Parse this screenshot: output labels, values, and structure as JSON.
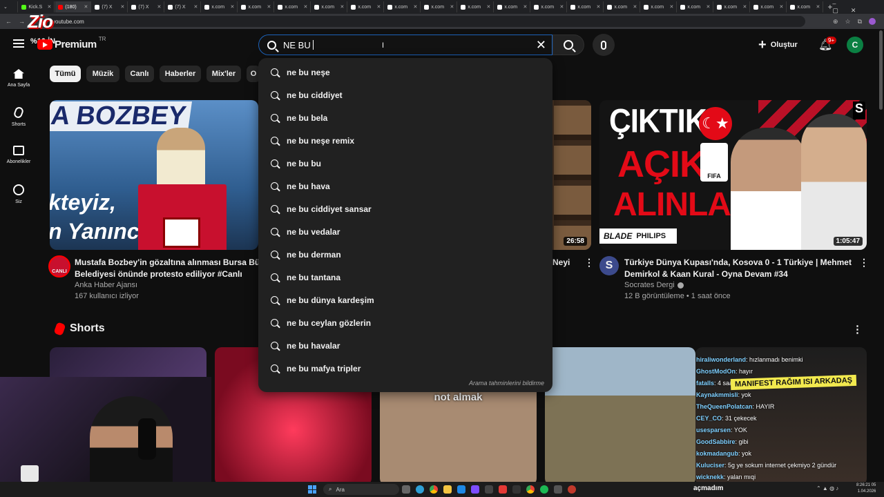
{
  "browser": {
    "tabs": [
      "Kick.S",
      "(180)",
      "(7) X",
      "(7) X",
      "(7) X",
      "x.com",
      "x.com",
      "x.com",
      "x.com",
      "x.com",
      "x.com",
      "x.com",
      "x.com",
      "x.com",
      "x.com",
      "x.com",
      "x.com",
      "x.com",
      "x.com",
      "x.com",
      "x.com",
      "x.com"
    ],
    "url": "youtube.com"
  },
  "overlay_logo": {
    "brand": "Zio",
    "promo": "%10 İN"
  },
  "header": {
    "premium_label": "Premium",
    "country_code": "TR",
    "search_value": "NE BU ",
    "create_label": "Oluştur",
    "notif_count": "9+",
    "avatar_letter": "C"
  },
  "sidebar": [
    {
      "label": "Ana Sayfa",
      "icon": "home-icon"
    },
    {
      "label": "Shorts",
      "icon": "shorts-icon"
    },
    {
      "label": "Abonelikler",
      "icon": "subscriptions-icon"
    },
    {
      "label": "Siz",
      "icon": "you-icon"
    }
  ],
  "chips": [
    "Tümü",
    "Müzik",
    "Canlı",
    "Haberler",
    "Mix'ler",
    "O"
  ],
  "suggestions": [
    "ne bu neşe",
    "ne bu ciddiyet",
    "ne bu bela",
    "ne bu neşe remix",
    "ne bu bu",
    "ne bu hava",
    "ne bu ciddiyet sansar",
    "ne bu vedalar",
    "ne bu derman",
    "ne bu tantana",
    "ne bu dünya kardeşim",
    "ne bu ceylan gözlerin",
    "ne bu havalar",
    "ne bu mafya tripler"
  ],
  "report_label": "Arama tahminlerini bildirme",
  "videos": [
    {
      "title_line1": "Mustafa Bozbey'in gözaltına alınması Bursa Büyük",
      "title_line2": "Belediyesi önünde protesto ediliyor #Canlı",
      "channel": "Anka Haber Ajansı",
      "meta": "167 kullanıcı izliyor",
      "live_badge": "CANLI",
      "thumb_text1": "A BOZBEY",
      "thumb_text2": "kteyiz,",
      "thumb_text3": "n Yanınc"
    },
    {
      "title_fragment": "Neyi",
      "duration": "26:58"
    },
    {
      "title_line1": "Türkiye Dünya Kupası'nda, Kosova 0 - 1 Türkiye | Mehmet",
      "title_line2": "Demirkol & Kaan Kural - Oyna Devam #34",
      "channel": "Socrates Dergi",
      "meta": "12 B görüntüleme • 1 saat önce",
      "duration": "1:05:47",
      "channel_initial": "S",
      "thumb_line1": "ÇIKTIK",
      "thumb_line2": "AÇIK",
      "thumb_line3": "ALINLA",
      "sponsor1": "BLADE",
      "sponsor2": "PHILIPS",
      "fifa": "FIFA",
      "corner": "S"
    }
  ],
  "shorts_label": "Shorts",
  "short_caption": "not almak",
  "stream_banner": "MANIFEST RAĞIM ISI ARKADAŞ",
  "chat": [
    {
      "user": "hiraliwonderland",
      "msg": "hızlanmadı benimki"
    },
    {
      "user": "GhostModOn",
      "msg": "hayır"
    },
    {
      "user": "fatalls",
      "msg": "4 saat..."
    },
    {
      "user": "Kaynakmmisli",
      "msg": "yok"
    },
    {
      "user": "TheQueenPolatcan",
      "msg": "HAYIR"
    },
    {
      "user": "CEY_CO",
      "msg": "31 çekecek"
    },
    {
      "user": "usesparsen",
      "msg": "YOK"
    },
    {
      "user": "GoodSabbire",
      "msg": "gibi"
    },
    {
      "user": "kokmadangub",
      "msg": "yok"
    },
    {
      "user": "Kuluciser",
      "msg": "5g ye sokum internet çekmiyo 2 gündür"
    },
    {
      "user": "wicknekk",
      "msg": "yalan mıqi"
    }
  ],
  "taskbar": {
    "search_label": "Ara",
    "active_title": "açmadım",
    "time": "8:26:21 05",
    "date": "1.04.2026"
  }
}
